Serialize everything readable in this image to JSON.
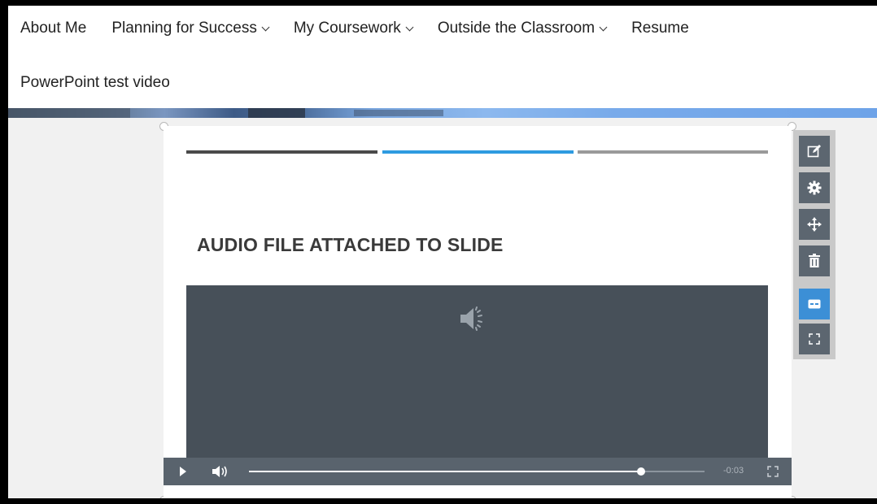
{
  "nav": {
    "items": [
      {
        "label": "About Me",
        "dropdown": false
      },
      {
        "label": "Planning for Success",
        "dropdown": true
      },
      {
        "label": "My Coursework",
        "dropdown": true
      },
      {
        "label": "Outside the Classroom",
        "dropdown": true
      },
      {
        "label": "Resume",
        "dropdown": false
      }
    ],
    "second_row_item": "PowerPoint test video"
  },
  "slide": {
    "title": "AUDIO FILE ATTACHED TO SLIDE",
    "bar_colors": [
      "#4a4a4a",
      "#2e9be0",
      "#9a9a9a"
    ]
  },
  "player": {
    "time_remaining": "-0:03",
    "progress": 0.86,
    "icons": [
      "play-icon",
      "volume-icon",
      "fullscreen-icon"
    ]
  },
  "toolbar": {
    "buttons": [
      "edit-icon",
      "settings-gear-icon",
      "move-icon",
      "trash-icon",
      "captions-icon",
      "expand-icon"
    ],
    "active_button": "captions-icon"
  },
  "colors": {
    "media_background": "#475059",
    "controls_background": "#59636d",
    "accent": "#3c8fd6"
  }
}
